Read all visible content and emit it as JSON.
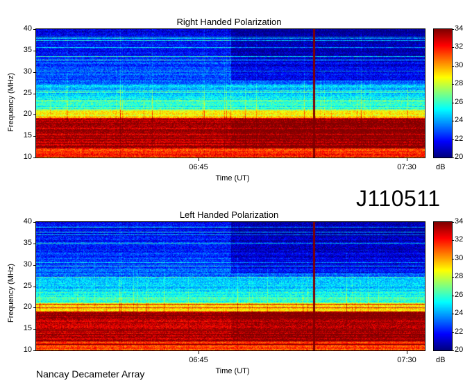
{
  "chart_data": [
    {
      "type": "heatmap",
      "title": "Right Handed Polarization",
      "xlabel": "Time (UT)",
      "ylabel": "Frequency (MHz)",
      "x_ticks": [
        "06:45",
        "07:30"
      ],
      "y_ticks": [
        10,
        15,
        20,
        25,
        30,
        35,
        40
      ],
      "ylim": [
        10,
        40
      ],
      "colorbar": {
        "label": "dB",
        "ticks": [
          20,
          22,
          24,
          26,
          28,
          30,
          32,
          34
        ],
        "range": [
          20,
          34
        ],
        "colormap": "jet"
      }
    },
    {
      "type": "heatmap",
      "title": "Left Handed Polarization",
      "xlabel": "Time (UT)",
      "ylabel": "Frequency (MHz)",
      "x_ticks": [
        "06:45",
        "07:30"
      ],
      "y_ticks": [
        10,
        15,
        20,
        25,
        30,
        35,
        40
      ],
      "ylim": [
        10,
        40
      ],
      "colorbar": {
        "label": "dB",
        "ticks": [
          20,
          22,
          24,
          26,
          28,
          30,
          32,
          34
        ],
        "range": [
          20,
          34
        ],
        "colormap": "jet"
      }
    }
  ],
  "observation_id": "J110511",
  "instrument": "Nancay Decameter Array"
}
